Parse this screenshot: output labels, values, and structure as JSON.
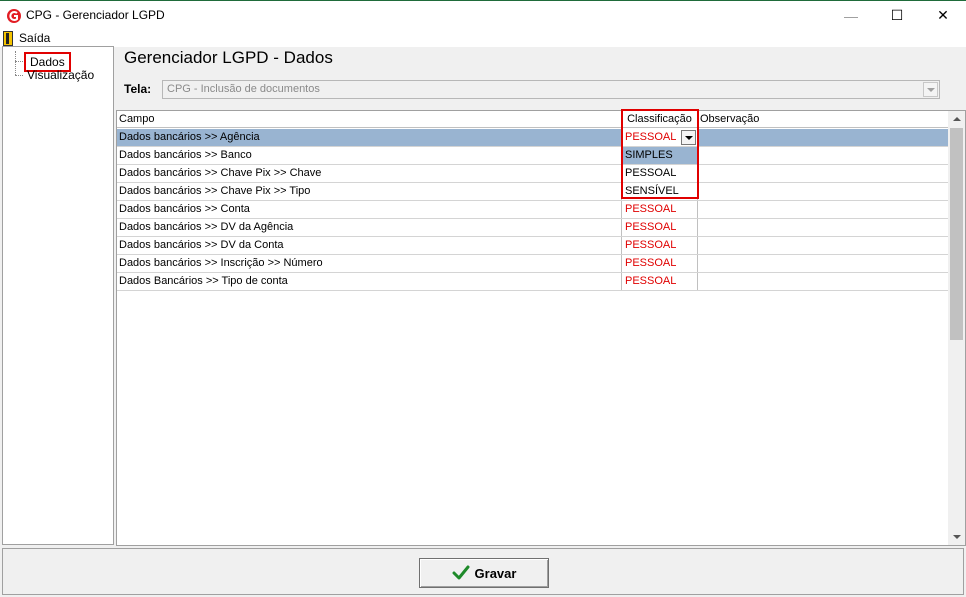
{
  "window": {
    "title": "CPG - Gerenciador LGPD",
    "controls": {
      "minimize": "—",
      "maximize": "☐",
      "close": "✕"
    }
  },
  "menu": {
    "exit_label": "Saída",
    "exit_icon": "door-exit-icon"
  },
  "tree": {
    "items": [
      {
        "label": "Dados",
        "highlighted": true
      },
      {
        "label": "Visualização",
        "highlighted": false
      }
    ]
  },
  "main": {
    "title": "Gerenciador LGPD - Dados",
    "tela_label": "Tela:",
    "tela_value": "CPG - Inclusão de documentos"
  },
  "grid": {
    "columns": [
      "Campo",
      "Classificação",
      "Observação"
    ],
    "rows": [
      {
        "campo": "Dados bancários >> Agência",
        "classificacao": "PESSOAL",
        "observacao": ""
      },
      {
        "campo": "Dados bancários >> Banco",
        "classificacao": "",
        "observacao": ""
      },
      {
        "campo": "Dados bancários >> Chave Pix >> Chave",
        "classificacao": "",
        "observacao": ""
      },
      {
        "campo": "Dados bancários >> Chave Pix >> Tipo",
        "classificacao": "",
        "observacao": ""
      },
      {
        "campo": "Dados bancários >> Conta",
        "classificacao": "PESSOAL",
        "observacao": ""
      },
      {
        "campo": "Dados bancários >> DV da Agência",
        "classificacao": "PESSOAL",
        "observacao": ""
      },
      {
        "campo": "Dados bancários >> DV da Conta",
        "classificacao": "PESSOAL",
        "observacao": ""
      },
      {
        "campo": "Dados bancários >> Inscrição >> Número",
        "classificacao": "PESSOAL",
        "observacao": ""
      },
      {
        "campo": "Dados Bancários >> Tipo de conta",
        "classificacao": "PESSOAL",
        "observacao": ""
      }
    ],
    "dropdown_options": [
      "SIMPLES",
      "PESSOAL",
      "SENSÍVEL"
    ],
    "dropdown_selected": "SIMPLES"
  },
  "footer": {
    "gravar_label": "Gravar",
    "gravar_icon": "checkmark-icon"
  },
  "colors": {
    "accent_red": "#e00000",
    "selection": "#99b4d1"
  }
}
